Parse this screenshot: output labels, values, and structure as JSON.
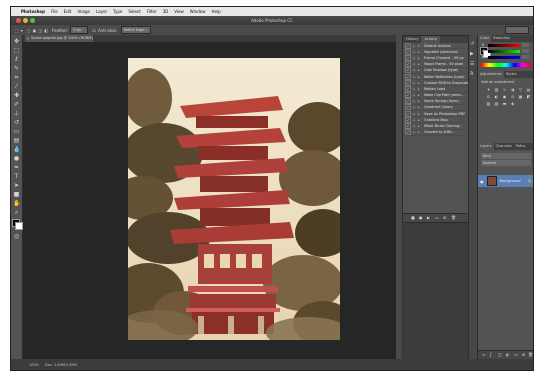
{
  "menubar": {
    "items": [
      "Photoshop",
      "File",
      "Edit",
      "Image",
      "Layer",
      "Type",
      "Select",
      "Filter",
      "3D",
      "View",
      "Window",
      "Help"
    ]
  },
  "window": {
    "title": "Adobe Photoshop CC"
  },
  "options_bar": {
    "feather_label": "Feather:",
    "feather_value": "0 px",
    "anti_alias": "Anti-alias",
    "refine_edge": "Refine Edge..."
  },
  "document": {
    "tab_label": "Spoke pagoda.jpg @ 100% (RGB/8)",
    "zoom": "100%",
    "doc_info": "Doc: 1.89M/1.89M"
  },
  "history_panel": {
    "tabs": [
      "History",
      "Actions"
    ],
    "rows": [
      "Default Actions",
      "Vignette (selection)",
      "Frame Channel - 50 px",
      "Wood Frame - 50 pixel",
      "Cast Shadow (type)",
      "Water Reflection (type)",
      "Custom RGB to Grayscale",
      "Molten Lead",
      "Make Clip Path (selec...",
      "Sepia Toning (layer)",
      "Quadrant Colors",
      "Save As Photoshop PDF",
      "Gradient Map",
      "Mixer Brush Cloning...",
      "Convert to 8-Bit..."
    ]
  },
  "color_panel": {
    "tabs": [
      "Color",
      "Swatches"
    ],
    "channels": [
      "R",
      "G",
      "B"
    ]
  },
  "adjustments_panel": {
    "tabs": [
      "Adjustments",
      "Styles"
    ],
    "add_label": "Add an adjustment"
  },
  "layers_panel": {
    "tabs": [
      "Layers",
      "Channels",
      "Paths"
    ],
    "kind_label": "Kind",
    "blend_mode": "Normal",
    "layer_name": "Background"
  },
  "colors": {
    "ui_dark": "#3c3c3c",
    "panel": "#535353",
    "canvas": "#262626",
    "selection": "#5a7fb5"
  }
}
